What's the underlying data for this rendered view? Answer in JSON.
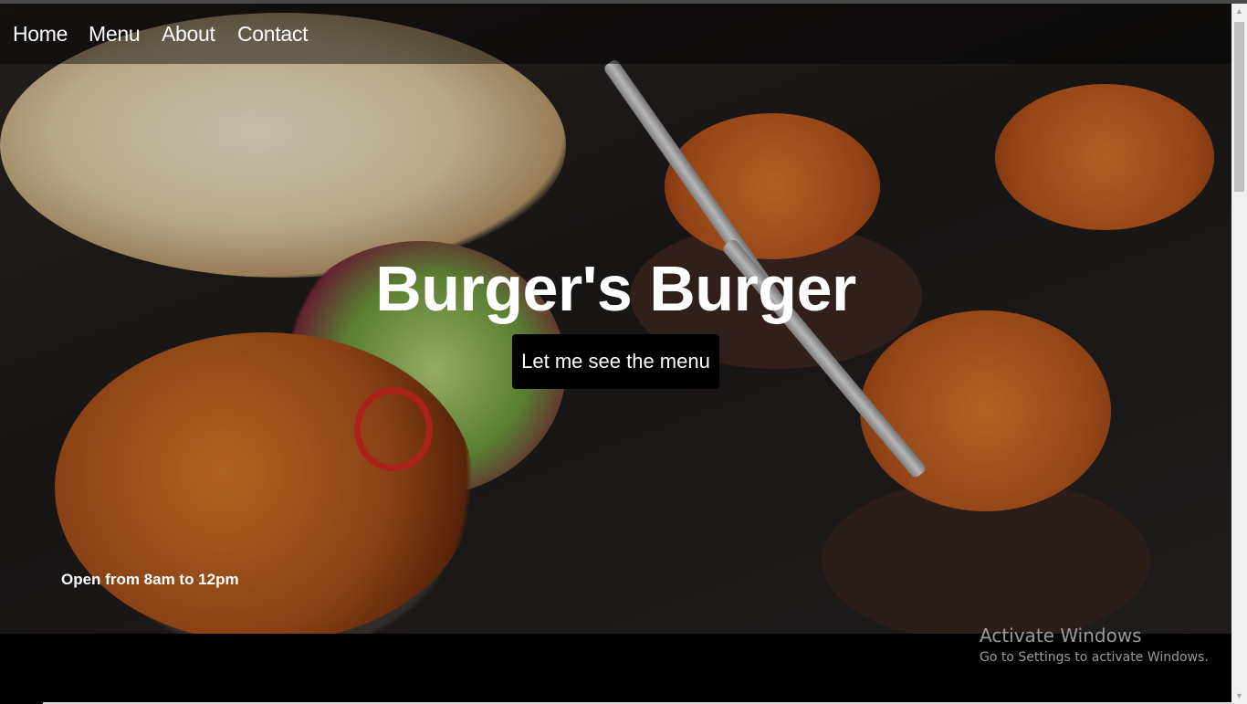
{
  "nav": {
    "items": [
      {
        "label": "Home"
      },
      {
        "label": "Menu"
      },
      {
        "label": "About"
      },
      {
        "label": "Contact"
      }
    ]
  },
  "hero": {
    "title": "Burger's Burger",
    "button_label": "Let me see the menu",
    "hours_text": "Open from 8am to 12pm"
  },
  "windows_overlay": {
    "title": "Activate Windows",
    "subtitle": "Go to Settings to activate Windows."
  },
  "scrollbar": {
    "up_icon": "triangle-up",
    "down_icon": "triangle-down"
  }
}
